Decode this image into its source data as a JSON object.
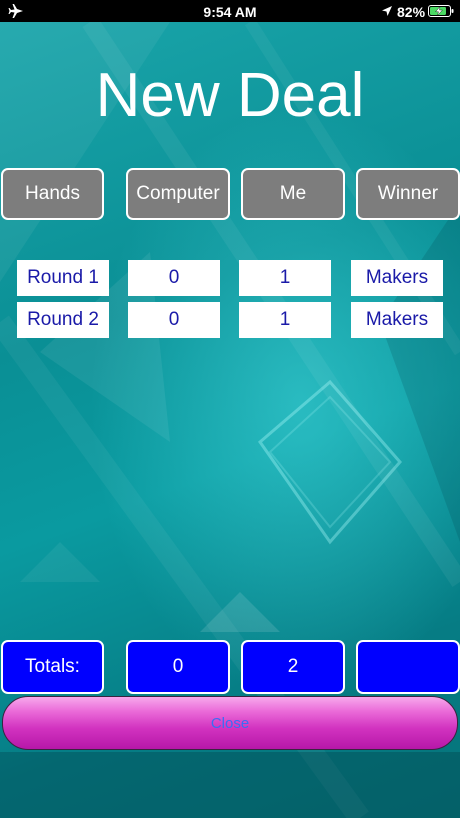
{
  "status_bar": {
    "time": "9:54 AM",
    "battery_percent": "82%",
    "icons": [
      "airplane-icon",
      "location-icon",
      "battery-charging-icon"
    ]
  },
  "title": "New Deal",
  "columns": [
    "Hands",
    "Computer",
    "Me",
    "Winner"
  ],
  "rows": [
    {
      "hand": "Round 1",
      "computer": "0",
      "me": "1",
      "winner": "Makers"
    },
    {
      "hand": "Round 2",
      "computer": "0",
      "me": "1",
      "winner": "Makers"
    }
  ],
  "totals": {
    "label": "Totals:",
    "computer": "0",
    "me": "2",
    "winner": ""
  },
  "close_label": "Close",
  "colors": {
    "header_bg": "#7d7d7d",
    "totals_bg": "#0000ff",
    "cell_text": "#1a1aa8",
    "close_text": "#3b6df3"
  }
}
